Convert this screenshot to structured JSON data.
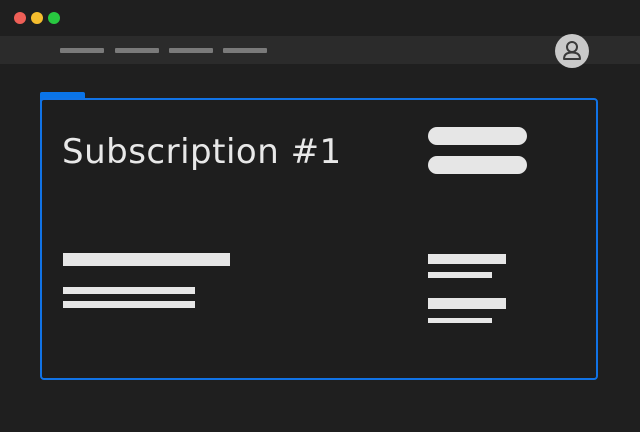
{
  "window": {
    "controls": [
      "close",
      "minimize",
      "maximize"
    ]
  },
  "nav": {
    "items": [
      "",
      "",
      "",
      ""
    ]
  },
  "user": {
    "avatar_icon": "user-icon"
  },
  "card": {
    "title": "Subscription #1"
  },
  "colors": {
    "accent": "#0a74e8",
    "background": "#1f1f1f",
    "navbar": "#2b2b2b",
    "placeholder": "#e6e6e6"
  }
}
